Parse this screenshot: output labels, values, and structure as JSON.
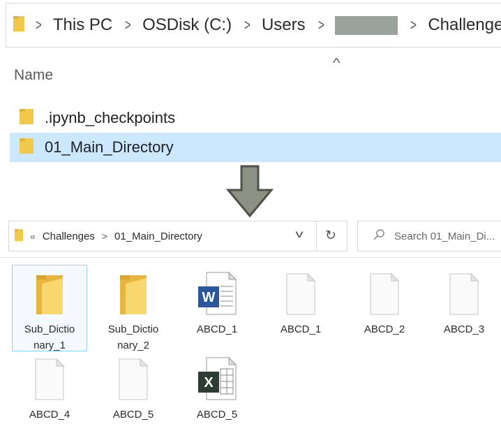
{
  "top": {
    "breadcrumb": [
      "This PC",
      "OSDisk (C:)",
      "Users",
      "Challenges"
    ],
    "column_header": "Name",
    "rows": [
      ".ipynb_checkpoints",
      "01_Main_Directory"
    ]
  },
  "bottom": {
    "address": [
      "Challenges",
      "01_Main_Directory"
    ],
    "search_placeholder": "Search 01_Main_Di...",
    "items": [
      {
        "label": "Sub_Dictio\nnary_1",
        "icon": "folder-icon"
      },
      {
        "label": "Sub_Dictio\nnary_2",
        "icon": "folder-icon"
      },
      {
        "label": "ABCD_1",
        "icon": "word-doc-icon"
      },
      {
        "label": "ABCD_1",
        "icon": "blank-file-icon"
      },
      {
        "label": "ABCD_2",
        "icon": "blank-file-icon"
      },
      {
        "label": "ABCD_3",
        "icon": "blank-file-icon"
      },
      {
        "label": "ABCD_4",
        "icon": "blank-file-icon"
      },
      {
        "label": "ABCD_5",
        "icon": "blank-file-icon"
      },
      {
        "label": "ABCD_5",
        "icon": "excel-doc-icon"
      }
    ]
  },
  "colors": {
    "folder": "#f2c84b",
    "selection": "#cce8ff",
    "word": "#2b579a",
    "excel": "#217346",
    "arrow": "#8c9183"
  }
}
